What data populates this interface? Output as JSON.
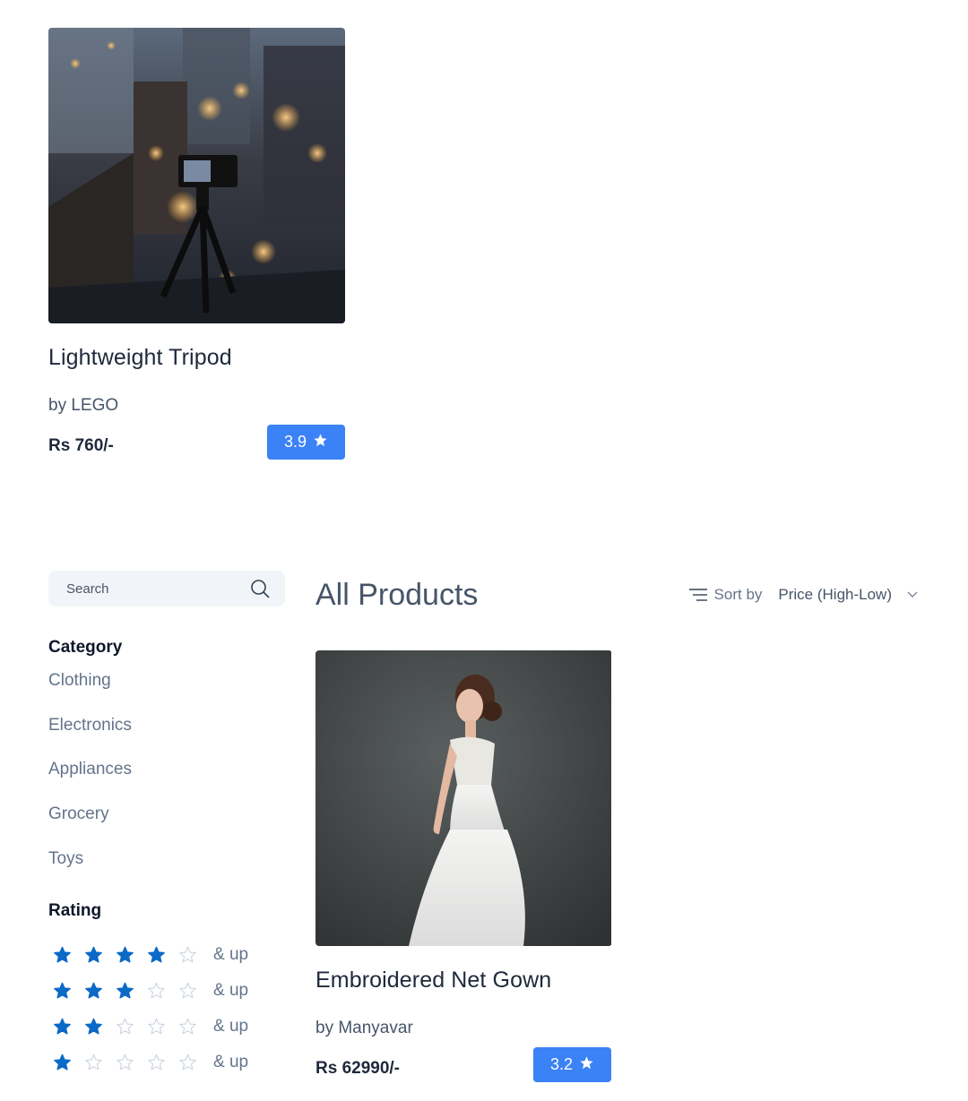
{
  "featured_product": {
    "title": "Lightweight Tripod",
    "brand": "by LEGO",
    "price": "Rs 760/-",
    "rating": "3.9",
    "image": "tripod-photo"
  },
  "sidebar": {
    "search": {
      "placeholder": "Search",
      "value": ""
    },
    "category_heading": "Category",
    "categories": [
      "Clothing",
      "Electronics",
      "Appliances",
      "Grocery",
      "Toys"
    ],
    "rating_heading": "Rating",
    "rating_filters": [
      {
        "stars": 4,
        "label": "& up"
      },
      {
        "stars": 3,
        "label": "& up"
      },
      {
        "stars": 2,
        "label": "& up"
      },
      {
        "stars": 1,
        "label": "& up"
      }
    ]
  },
  "main": {
    "title": "All Products",
    "sort_label": "Sort by",
    "sort_value": "Price (High-Low)",
    "products": [
      {
        "title": "Embroidered Net Gown",
        "brand": "by Manyavar",
        "price": "Rs 62990/-",
        "rating": "3.2",
        "image": "gown-photo"
      }
    ]
  },
  "colors": {
    "accent": "#3b82f6",
    "star_filled": "#0b69c7",
    "text_dark": "#1e293b",
    "text_muted": "#64748b"
  }
}
